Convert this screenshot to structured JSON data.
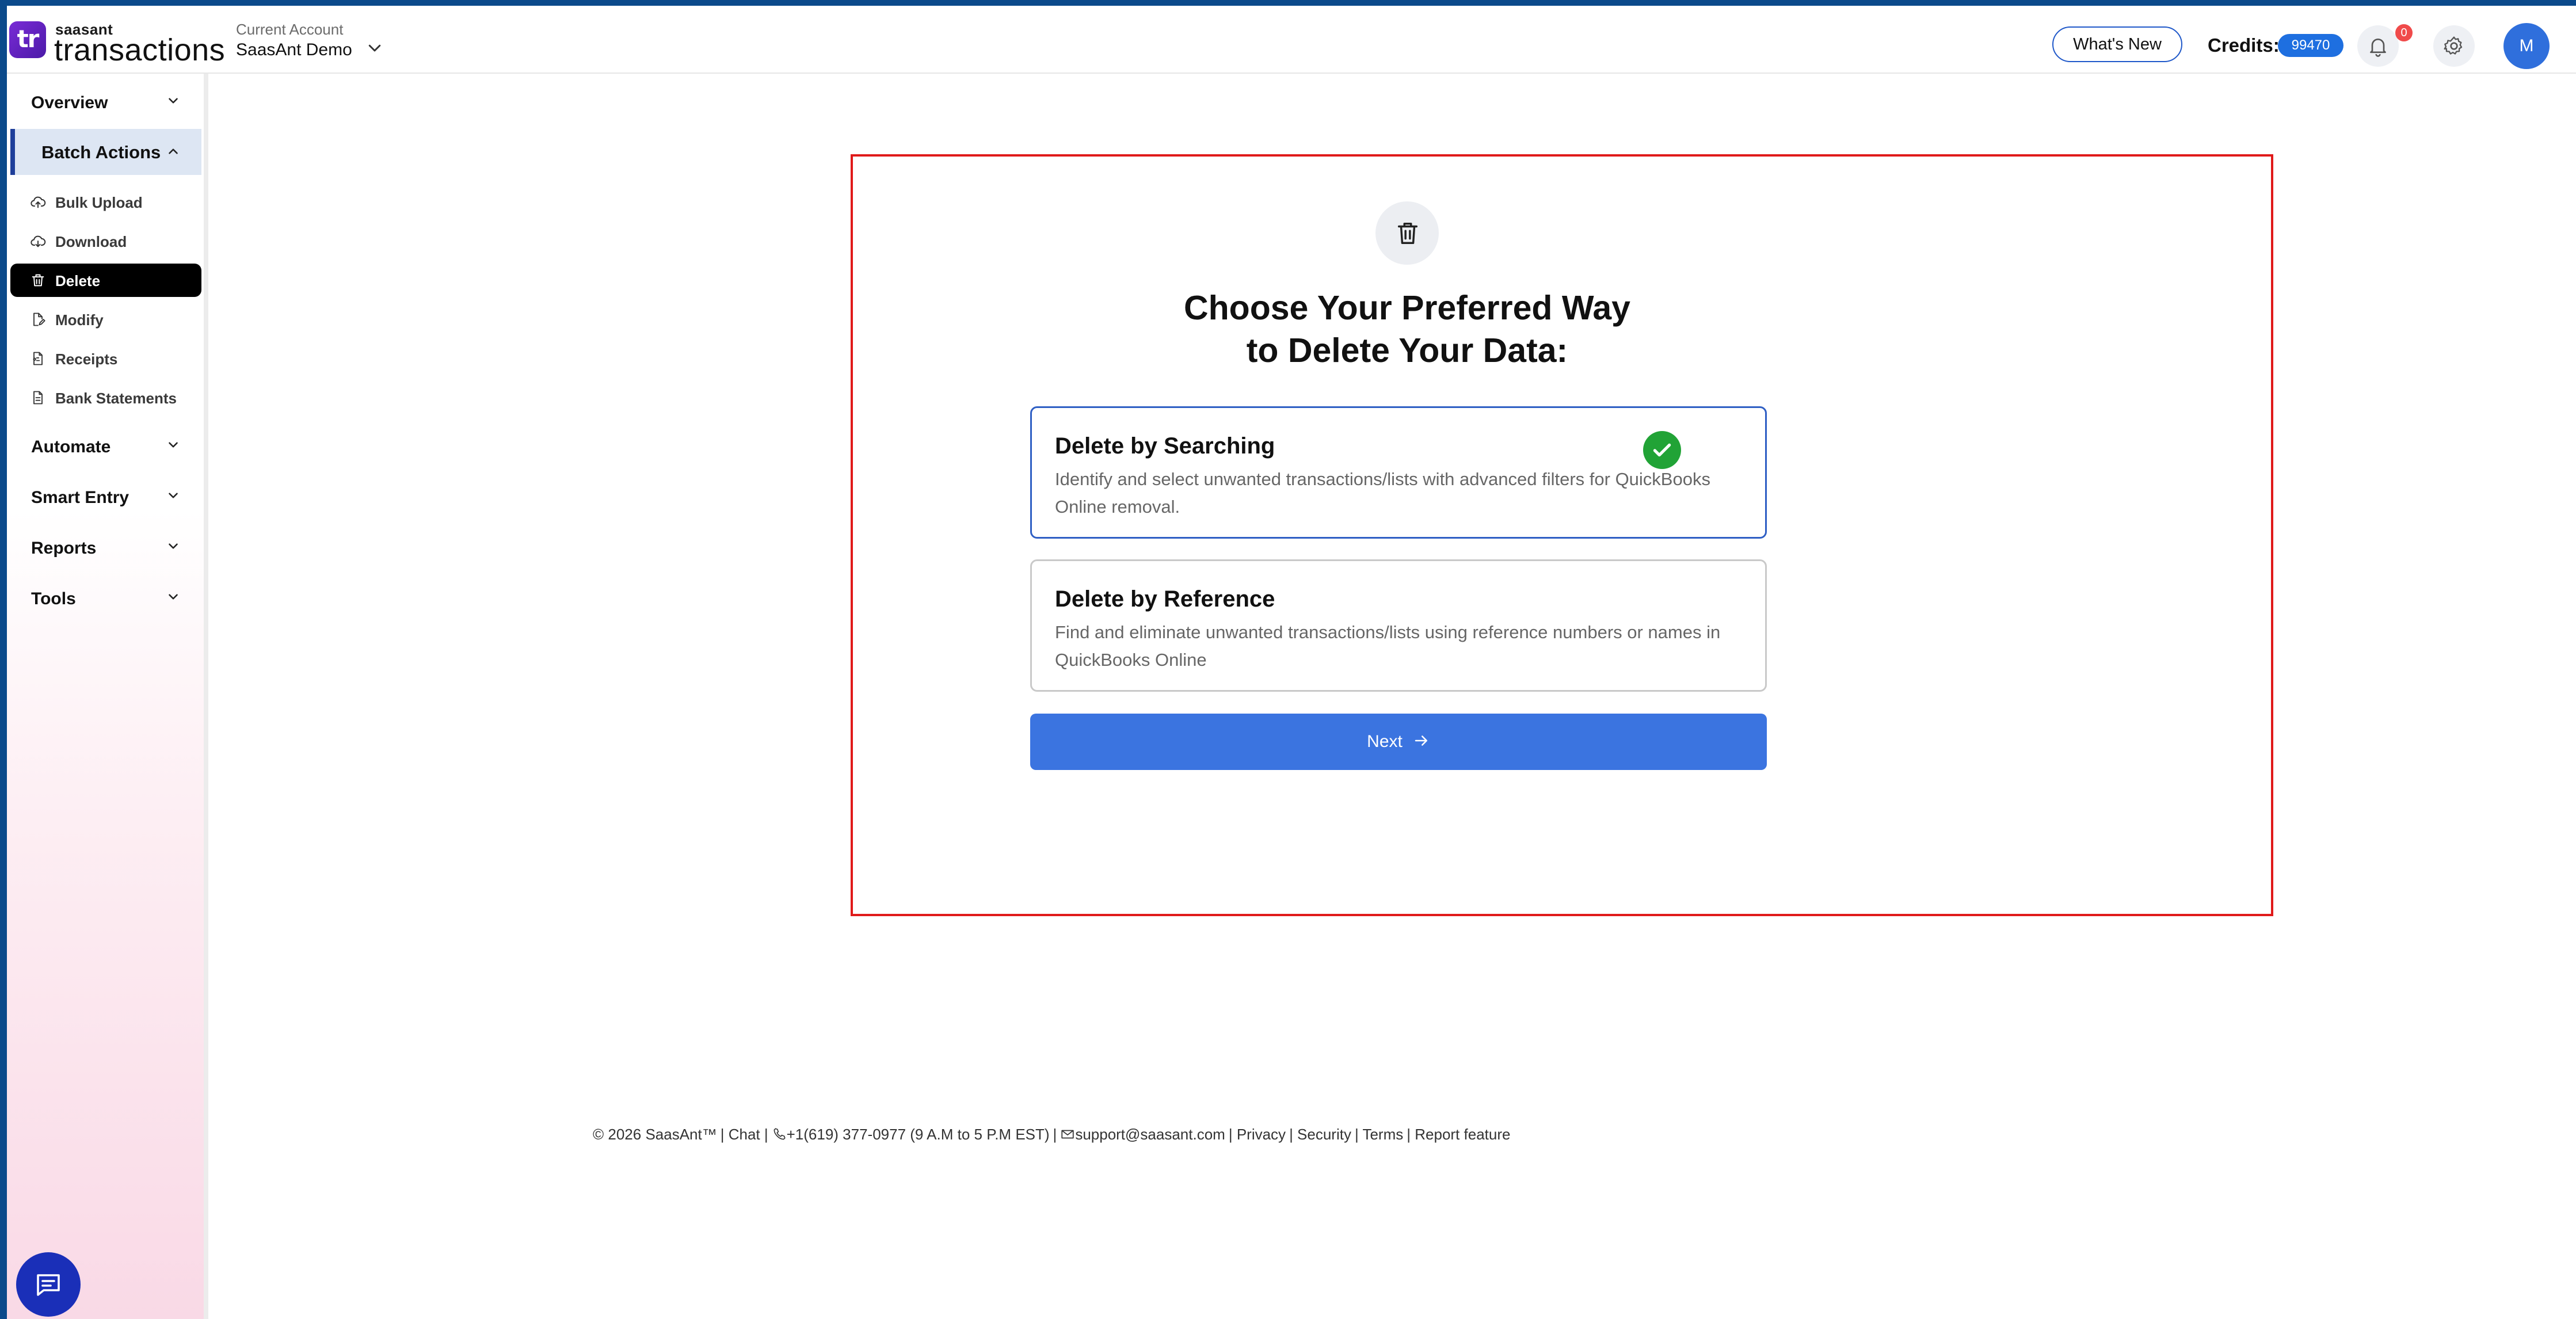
{
  "header": {
    "logo_brand": "saasant",
    "logo_product": "transactions",
    "logo_mark": "tr",
    "account_label": "Current Account",
    "account_name": "SaasAnt Demo",
    "whats_new": "What's New",
    "credits_label": "Credits:",
    "credits_value": "99470",
    "notification_count": "0",
    "avatar_initial": "M"
  },
  "sidebar": {
    "sections": {
      "overview": "Overview",
      "batch_actions": "Batch Actions",
      "automate": "Automate",
      "smart_entry": "Smart Entry",
      "reports": "Reports",
      "tools": "Tools"
    },
    "batch_items": [
      {
        "label": "Bulk Upload",
        "icon": "upload-icon"
      },
      {
        "label": "Download",
        "icon": "download-icon"
      },
      {
        "label": "Delete",
        "icon": "trash-icon"
      },
      {
        "label": "Modify",
        "icon": "edit-file-icon"
      },
      {
        "label": "Receipts",
        "icon": "receipt-icon"
      },
      {
        "label": "Bank Statements",
        "icon": "statement-icon"
      }
    ],
    "active_item": "Delete"
  },
  "main": {
    "headline_line1": "Choose Your Preferred Way",
    "headline_line2": "to Delete Your Data:",
    "options": [
      {
        "title": "Delete by Searching",
        "description": "Identify and select unwanted transactions/lists with advanced filters for QuickBooks Online removal.",
        "selected": true
      },
      {
        "title": "Delete by Reference",
        "description": "Find and eliminate unwanted transactions/lists using reference numbers or names in QuickBooks Online",
        "selected": false
      }
    ],
    "next_label": "Next"
  },
  "footer": {
    "copyright": "© 2026 SaasAnt™",
    "chat": "| Chat  |",
    "phone": "+1(619) 377-0977 (9 A.M to 5 P.M EST)",
    "sep1": "|",
    "email": "support@saasant.com",
    "privacy": "| Privacy",
    "security": "| Security",
    "terms": "| Terms",
    "report": "| Report feature"
  },
  "colors": {
    "accent_blue": "#3b74e0",
    "brand_navy": "#0b4a8b",
    "selected_check": "#21a336",
    "highlight_box": "#e01a1a"
  }
}
